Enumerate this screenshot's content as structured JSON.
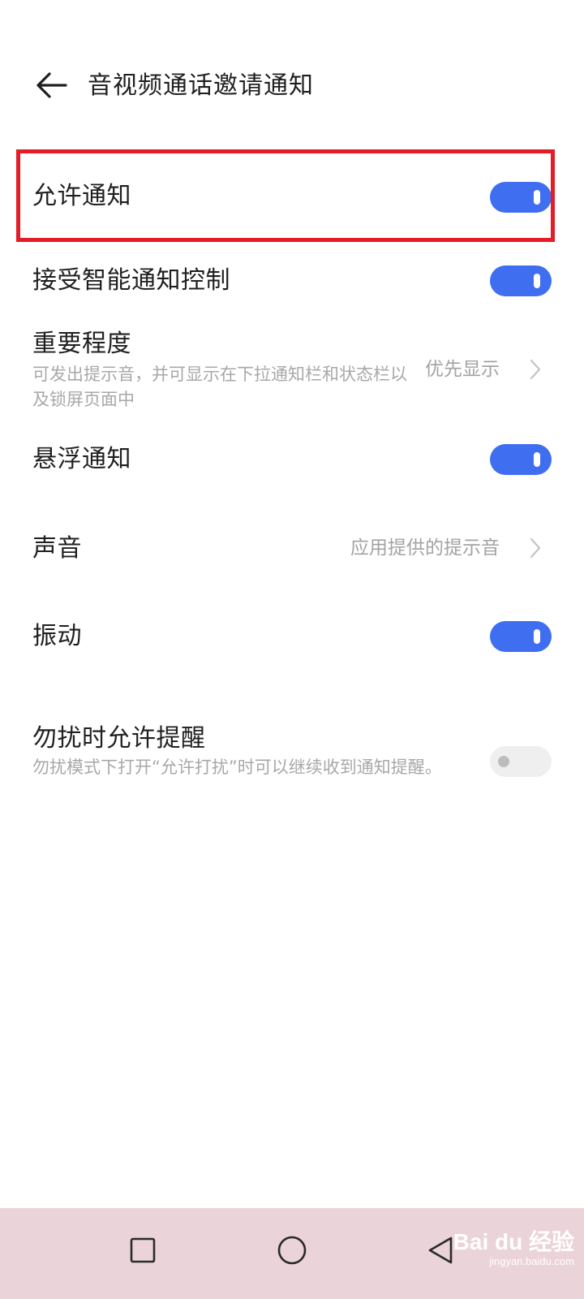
{
  "header": {
    "title": "音视频通话邀请通知",
    "back_icon": "arrow-left-icon"
  },
  "settings": [
    {
      "label": "允许通知",
      "control": "toggle",
      "on": true
    },
    {
      "label": "接受智能通知控制",
      "control": "toggle",
      "on": true
    },
    {
      "label": "重要程度",
      "description": "可发出提示音，并可显示在下拉通知栏和状态栏以及锁屏页面中",
      "value": "优先显示",
      "control": "chevron"
    },
    {
      "label": "悬浮通知",
      "control": "toggle",
      "on": true
    },
    {
      "label": "声音",
      "value": "应用提供的提示音",
      "control": "chevron"
    },
    {
      "label": "振动",
      "control": "toggle",
      "on": true
    },
    {
      "label": "勿扰时允许提醒",
      "description": "勿扰模式下打开“允许打扰”时可以继续收到通知提醒。",
      "control": "toggle",
      "on": false
    }
  ],
  "colors": {
    "toggle_on": "#3f6ff0",
    "toggle_off": "#efefef",
    "highlight_border": "#e41c27",
    "navbar_bg": "#ead3d9"
  },
  "navbar": {
    "recents_icon": "square-icon",
    "home_icon": "circle-icon",
    "back_icon": "triangle-back-icon"
  },
  "watermark": {
    "main": "Bai du 经验",
    "url": "jingyan.baidu.com"
  }
}
